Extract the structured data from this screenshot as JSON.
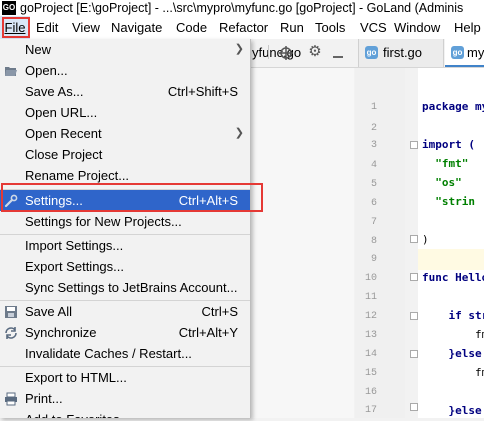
{
  "window": {
    "app_icon_text": "GO",
    "title": "goProject [E:\\goProject] - ...\\src\\mypro\\myfunc.go [goProject] - GoLand (Adminis"
  },
  "menubar": [
    "File",
    "Edit",
    "View",
    "Navigate",
    "Code",
    "Refactor",
    "Run",
    "Tools",
    "VCS",
    "Window",
    "Help"
  ],
  "editor": {
    "left_tab": "yfunc.go",
    "tabs": [
      {
        "label": "first.go",
        "active": false
      },
      {
        "label": "my",
        "active": true
      }
    ],
    "lines": [
      {
        "n": "1",
        "code": "package my"
      },
      {
        "n": "2",
        "code": ""
      },
      {
        "n": "3",
        "code": "import ("
      },
      {
        "n": "4",
        "code": "  \"fmt\""
      },
      {
        "n": "5",
        "code": "  \"os\""
      },
      {
        "n": "6",
        "code": "  \"strin"
      },
      {
        "n": "7",
        "code": ""
      },
      {
        "n": "8",
        "code": ")"
      },
      {
        "n": "9",
        "code": ""
      },
      {
        "n": "10",
        "code": "func Hello"
      },
      {
        "n": "11",
        "code": ""
      },
      {
        "n": "12",
        "code": "    if str"
      },
      {
        "n": "13",
        "code": "        fmt"
      },
      {
        "n": "14",
        "code": "    }else"
      },
      {
        "n": "15",
        "code": "        fmt"
      },
      {
        "n": "16",
        "code": ""
      },
      {
        "n": "17",
        "code": "    }else"
      }
    ]
  },
  "file_menu": {
    "items": [
      {
        "label": "New",
        "shortcut": "",
        "submenu": true
      },
      {
        "label": "Open...",
        "shortcut": "",
        "icon": "folder-open-icon"
      },
      {
        "label": "Save As...",
        "shortcut": "Ctrl+Shift+S"
      },
      {
        "label": "Open URL...",
        "shortcut": ""
      },
      {
        "label": "Open Recent",
        "shortcut": "",
        "submenu": true
      },
      {
        "label": "Close Project",
        "shortcut": ""
      },
      {
        "label": "Rename Project...",
        "shortcut": ""
      },
      {
        "label": "Settings...",
        "shortcut": "Ctrl+Alt+S",
        "icon": "wrench-icon",
        "selected": true
      },
      {
        "label": "Settings for New Projects...",
        "shortcut": ""
      },
      {
        "label": "Import Settings...",
        "shortcut": ""
      },
      {
        "label": "Export Settings...",
        "shortcut": ""
      },
      {
        "label": "Sync Settings to JetBrains Account...",
        "shortcut": ""
      },
      {
        "label": "Save All",
        "shortcut": "Ctrl+S",
        "icon": "save-icon"
      },
      {
        "label": "Synchronize",
        "shortcut": "Ctrl+Alt+Y",
        "icon": "sync-icon"
      },
      {
        "label": "Invalidate Caches / Restart...",
        "shortcut": ""
      },
      {
        "label": "Export to HTML...",
        "shortcut": ""
      },
      {
        "label": "Print...",
        "shortcut": "",
        "icon": "print-icon"
      },
      {
        "label": "Add to Favorites",
        "shortcut": ""
      }
    ]
  },
  "colors": {
    "selection": "#2f65ca",
    "highlight_box": "#e53935",
    "menu_bg": "#f2f2f2"
  }
}
